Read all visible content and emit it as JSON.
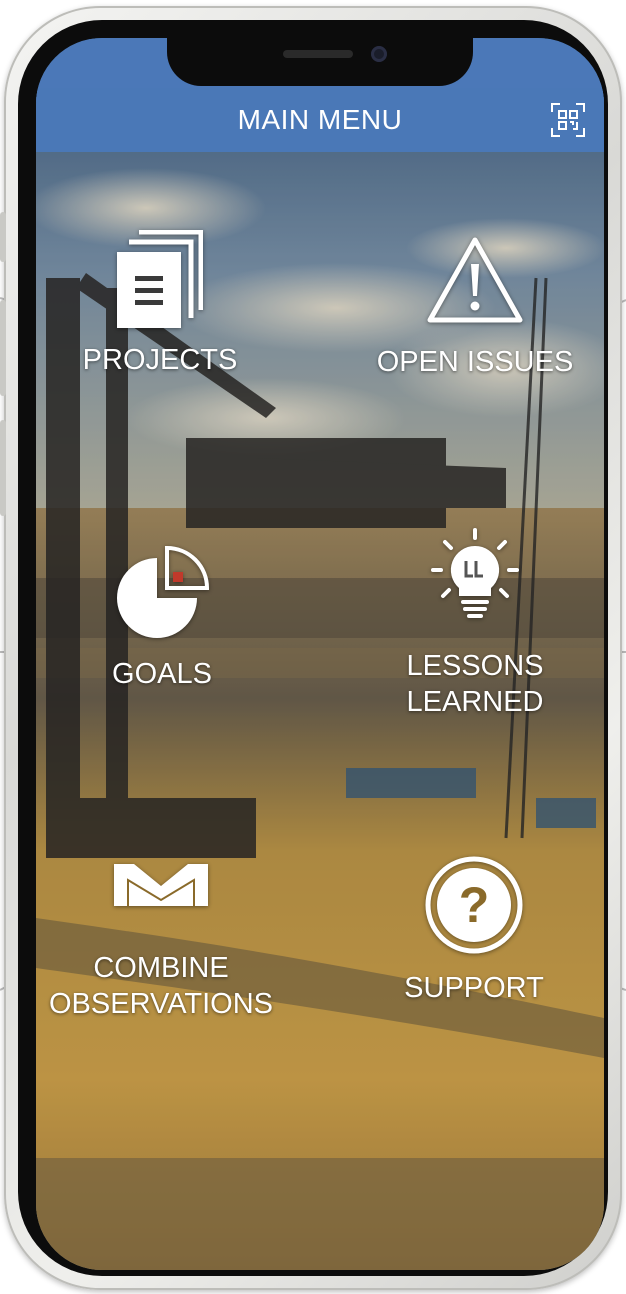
{
  "header": {
    "title": "MAIN MENU"
  },
  "menu": {
    "projects": {
      "label": "PROJECTS"
    },
    "open_issues": {
      "label": "OPEN ISSUES"
    },
    "goals": {
      "label": "GOALS"
    },
    "lessons_learned": {
      "line1": "LESSONS",
      "line2": "LEARNED"
    },
    "combine_observations": {
      "line1": "COMBINE",
      "line2": "OBSERVATIONS"
    },
    "support": {
      "label": "SUPPORT"
    }
  },
  "icons": {
    "qr_scan": "qr-scan-icon",
    "projects": "documents-icon",
    "open_issues": "warning-triangle-icon",
    "goals": "pie-chart-icon",
    "lessons_learned": "lightbulb-icon",
    "combine_observations": "merge-envelope-icon",
    "support": "question-circle-icon"
  },
  "colors": {
    "header_bg": "#4a78b7",
    "text": "#ffffff"
  }
}
